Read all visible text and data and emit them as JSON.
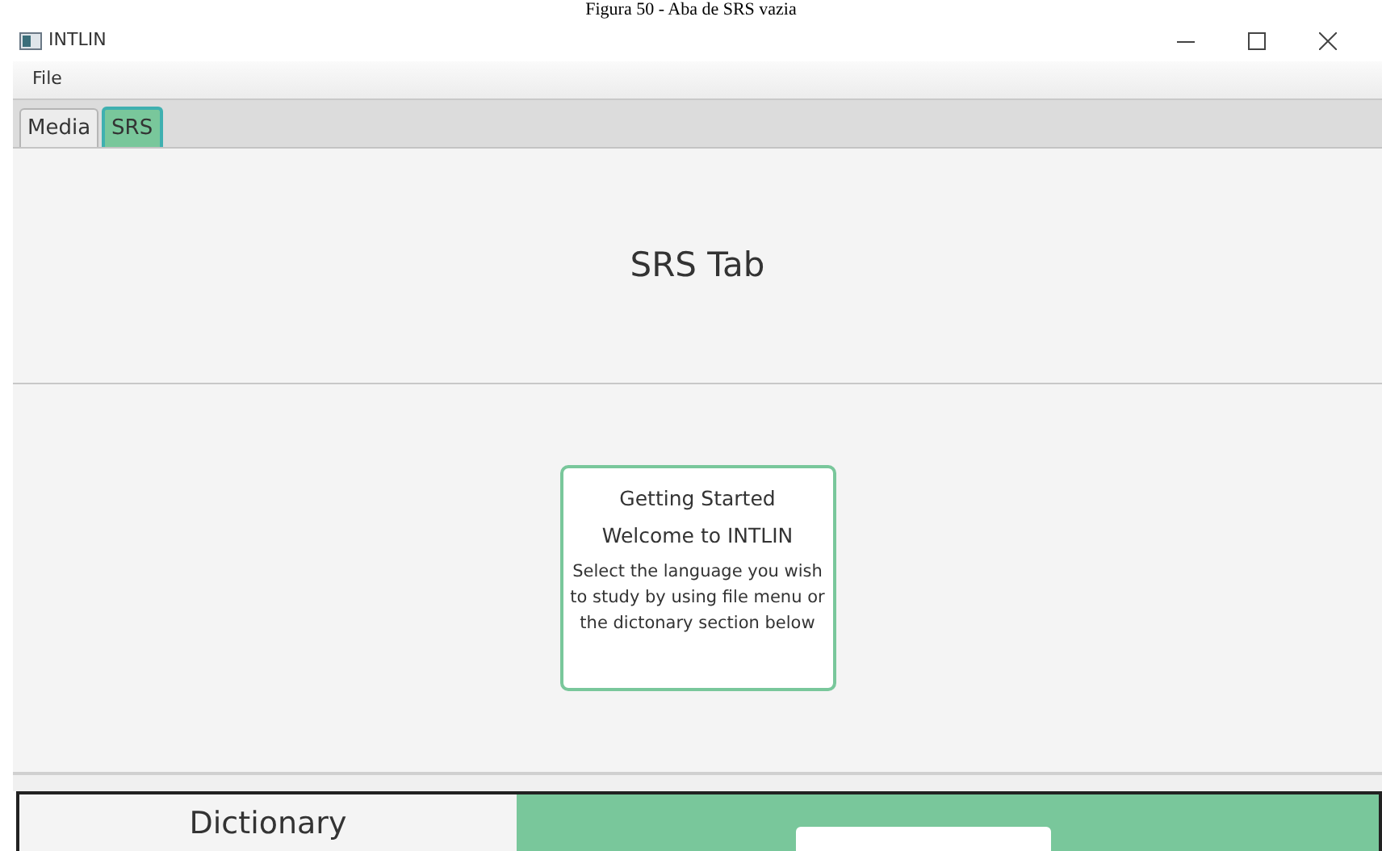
{
  "caption": "Figura 50 - Aba de SRS vazia",
  "window": {
    "title": "INTLIN"
  },
  "menu": [
    "File"
  ],
  "tabs": [
    {
      "label": "Media",
      "selected": false
    },
    {
      "label": "SRS",
      "selected": true
    }
  ],
  "header": "SRS Tab",
  "card": {
    "title": "Getting Started",
    "subtitle": "Welcome to INTLIN",
    "body": "Select the language you wish to study by using file menu or the dictonary section below"
  },
  "dictionary": {
    "label": "Dictionary"
  }
}
